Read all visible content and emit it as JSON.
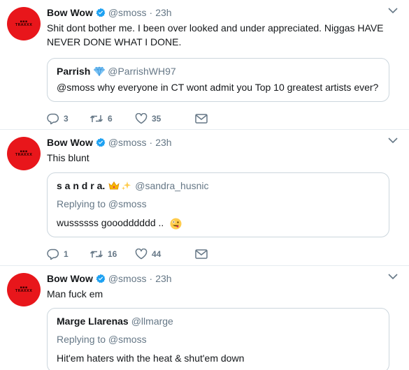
{
  "colors": {
    "accent": "#1da1f2",
    "secondary_text": "#657786",
    "avatar_red": "#e8161b",
    "border": "#e6ecf0"
  },
  "icons": [
    "verified-badge-icon",
    "caret-down-icon",
    "reply-icon",
    "retweet-icon",
    "like-icon",
    "dm-icon",
    "crown-emoji-icon",
    "sparkles-emoji-icon",
    "diamond-emoji-icon",
    "zany-face-emoji-icon"
  ],
  "tweets": [
    {
      "name": "Bow Wow",
      "handle": "@smoss",
      "dot": "·",
      "time": "23h",
      "text": "Shit dont bother me. I been over looked and under appreciated. Niggas HAVE NEVER DONE WHAT I DONE.",
      "quote": {
        "name": "Parrish",
        "handle": "@ParrishWH97",
        "replying": "",
        "text": "@smoss why everyone in CT wont admit you Top 10 greatest artists ever?"
      },
      "replies": "3",
      "retweets": "6",
      "likes": "35"
    },
    {
      "name": "Bow Wow",
      "handle": "@smoss",
      "dot": "·",
      "time": "23h",
      "text": "This blunt",
      "quote": {
        "name": "s a n d r a.",
        "handle": "@sandra_husnic",
        "replying": "Replying to @smoss",
        "text": "wussssss gooodddddd .."
      },
      "replies": "1",
      "retweets": "16",
      "likes": "44"
    },
    {
      "name": "Bow Wow",
      "handle": "@smoss",
      "dot": "·",
      "time": "23h",
      "text": "Man fuck em",
      "quote": {
        "name": "Marge Llarenas",
        "handle": "@llmarge",
        "replying": "Replying to @smoss",
        "text": "Hit'em haters with the heat & shut'em down"
      }
    }
  ]
}
